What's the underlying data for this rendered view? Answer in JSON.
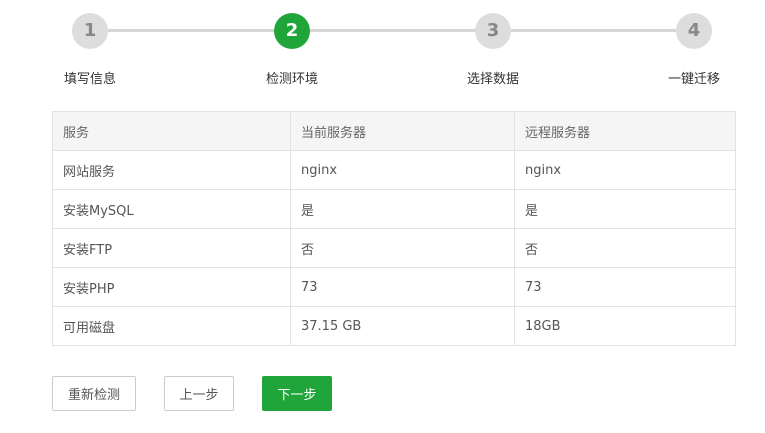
{
  "steps": [
    {
      "number": "1",
      "label": "填写信息",
      "state": "done"
    },
    {
      "number": "2",
      "label": "检测环境",
      "state": "active"
    },
    {
      "number": "3",
      "label": "选择数据",
      "state": "pending"
    },
    {
      "number": "4",
      "label": "一键迁移",
      "state": "pending"
    }
  ],
  "colors": {
    "accent": "#20a53a",
    "inactive_circle": "#dddddd",
    "line": "#d6d6d6"
  },
  "table": {
    "headers": [
      "服务",
      "当前服务器",
      "远程服务器"
    ],
    "rows": [
      [
        "网站服务",
        "nginx",
        "nginx"
      ],
      [
        "安装MySQL",
        "是",
        "是"
      ],
      [
        "安装FTP",
        "否",
        "否"
      ],
      [
        "安装PHP",
        "73",
        "73"
      ],
      [
        "可用磁盘",
        "37.15 GB",
        "18GB"
      ]
    ]
  },
  "buttons": {
    "recheck": "重新检测",
    "prev": "上一步",
    "next": "下一步"
  }
}
